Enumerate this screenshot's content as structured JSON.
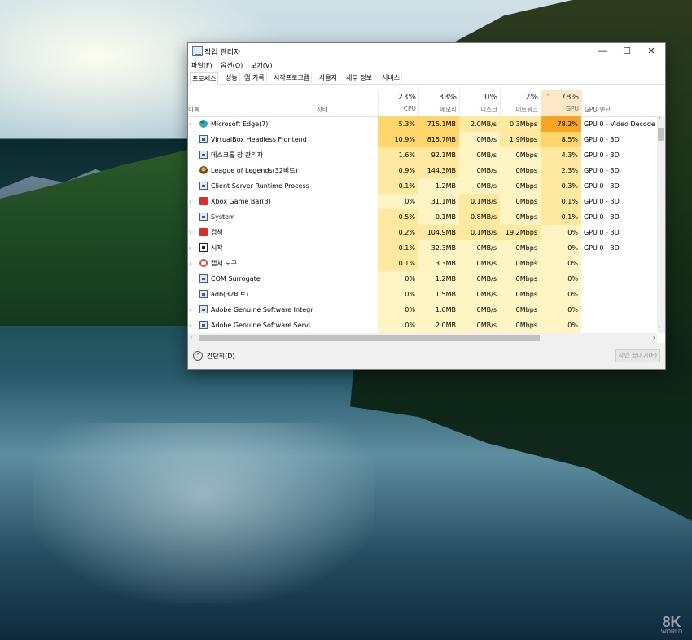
{
  "window": {
    "title": "작업 관리자",
    "min_glyph": "—",
    "max_glyph": "☐",
    "close_glyph": "✕"
  },
  "menu": [
    "파일(F)",
    "옵션(O)",
    "보기(V)"
  ],
  "tabs": [
    "프로세스",
    "성능",
    "앱 기록",
    "시작프로그램",
    "사용자",
    "세부 정보",
    "서비스"
  ],
  "headers": {
    "name": "이름",
    "status": "상태",
    "cpu": {
      "pct": "23%",
      "label": "CPU"
    },
    "memory": {
      "pct": "33%",
      "label": "메모리"
    },
    "disk": {
      "pct": "0%",
      "label": "디스크"
    },
    "network": {
      "pct": "2%",
      "label": "네트워크"
    },
    "gpu": {
      "pct": "78%",
      "label": "GPU"
    },
    "gpu_engine": "GPU 엔진",
    "sort_indicator": "˅"
  },
  "processes": [
    {
      "expand": "›",
      "icon": "edge-icon",
      "name": "Microsoft Edge(7)",
      "cpu": "5.3%",
      "memory": "715.1MB",
      "disk": "2.0MB/s",
      "network": "0.3Mbps",
      "gpu": "78.2%",
      "gpu_engine": "GPU 0 - Video Decode"
    },
    {
      "expand": "",
      "icon": "app-icon",
      "name": "VirtualBox Headless Frontend",
      "cpu": "10.9%",
      "memory": "815.7MB",
      "disk": "0MB/s",
      "network": "1.9Mbps",
      "gpu": "8.5%",
      "gpu_engine": "GPU 0 - 3D"
    },
    {
      "expand": "",
      "icon": "app-icon",
      "name": "데스크톱 창 관리자",
      "cpu": "1.6%",
      "memory": "92.1MB",
      "disk": "0MB/s",
      "network": "0Mbps",
      "gpu": "4.3%",
      "gpu_engine": "GPU 0 - 3D"
    },
    {
      "expand": "",
      "icon": "league-icon",
      "name": "League of Legends(32비트)",
      "cpu": "0.9%",
      "memory": "144.3MB",
      "disk": "0MB/s",
      "network": "0Mbps",
      "gpu": "2.3%",
      "gpu_engine": "GPU 0 - 3D"
    },
    {
      "expand": "",
      "icon": "app-icon",
      "name": "Client Server Runtime Process",
      "cpu": "0.1%",
      "memory": "1.2MB",
      "disk": "0MB/s",
      "network": "0Mbps",
      "gpu": "0.3%",
      "gpu_engine": "GPU 0 - 3D"
    },
    {
      "expand": "›",
      "icon": "xbox-icon",
      "name": "Xbox Game Bar(3)",
      "cpu": "0%",
      "memory": "31.1MB",
      "disk": "0.1MB/s",
      "network": "0Mbps",
      "gpu": "0.1%",
      "gpu_engine": "GPU 0 - 3D"
    },
    {
      "expand": "",
      "icon": "app-icon",
      "name": "System",
      "cpu": "0.5%",
      "memory": "0.1MB",
      "disk": "0.8MB/s",
      "network": "0Mbps",
      "gpu": "0.1%",
      "gpu_engine": "GPU 0 - 3D"
    },
    {
      "expand": "›",
      "icon": "search-icon",
      "name": "검색",
      "cpu": "0.2%",
      "memory": "104.9MB",
      "disk": "0.1MB/s",
      "network": "19.2Mbps",
      "gpu": "0%",
      "gpu_engine": "GPU 0 - 3D"
    },
    {
      "expand": "›",
      "icon": "start-icon",
      "name": "시작",
      "cpu": "0.1%",
      "memory": "32.3MB",
      "disk": "0MB/s",
      "network": "0Mbps",
      "gpu": "0%",
      "gpu_engine": "GPU 0 - 3D"
    },
    {
      "expand": "›",
      "icon": "snip-icon",
      "name": "캡처 도구",
      "cpu": "0.1%",
      "memory": "3.3MB",
      "disk": "0MB/s",
      "network": "0Mbps",
      "gpu": "0%",
      "gpu_engine": ""
    },
    {
      "expand": "",
      "icon": "app-icon",
      "name": "COM Surrogate",
      "cpu": "0%",
      "memory": "1.2MB",
      "disk": "0MB/s",
      "network": "0Mbps",
      "gpu": "0%",
      "gpu_engine": ""
    },
    {
      "expand": "",
      "icon": "app-icon",
      "name": "adb(32비트)",
      "cpu": "0%",
      "memory": "1.5MB",
      "disk": "0MB/s",
      "network": "0Mbps",
      "gpu": "0%",
      "gpu_engine": ""
    },
    {
      "expand": "›",
      "icon": "app-icon",
      "name": "Adobe Genuine Software Integr...",
      "cpu": "0%",
      "memory": "1.6MB",
      "disk": "0MB/s",
      "network": "0Mbps",
      "gpu": "0%",
      "gpu_engine": ""
    },
    {
      "expand": "›",
      "icon": "app-icon",
      "name": "Adobe Genuine Software Servi...",
      "cpu": "0%",
      "memory": "2.0MB",
      "disk": "0MB/s",
      "network": "0Mbps",
      "gpu": "0%",
      "gpu_engine": ""
    }
  ],
  "scroll": {
    "left": "‹",
    "right": "›",
    "up": "˄",
    "down": "˅"
  },
  "footer": {
    "fewer_details": "간단히(D)",
    "fewer_icon": "⌃",
    "end_task": "작업 끝내기(E)"
  },
  "watermark": {
    "big": "8K",
    "small": "WORLD"
  },
  "colors": {
    "heat_low": "#fff4c4",
    "heat_mid": "#ffe9a0",
    "heat_high": "#ffd66b",
    "gpu_hot": "#f7a623",
    "gpu_header": "#fce8c4"
  }
}
